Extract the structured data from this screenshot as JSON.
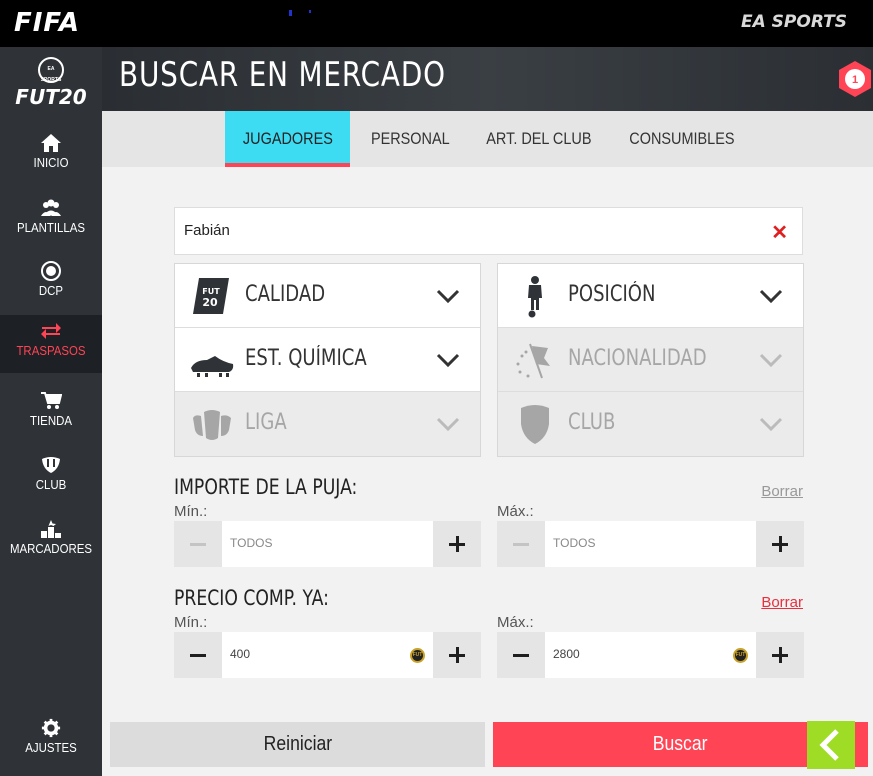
{
  "topbar": {
    "brand": "FIFA",
    "publisher": "EA SPORTS"
  },
  "sidebar": {
    "logo_small": "EA SPORTS",
    "logo": "FUT20",
    "items": [
      {
        "label": "INICIO",
        "icon": "home-icon"
      },
      {
        "label": "PLANTILLAS",
        "icon": "squads-icon"
      },
      {
        "label": "DCP",
        "icon": "sbc-icon"
      },
      {
        "label": "TRASPASOS",
        "icon": "transfers-icon",
        "active": true
      },
      {
        "label": "TIENDA",
        "icon": "store-icon"
      },
      {
        "label": "CLUB",
        "icon": "club-icon"
      },
      {
        "label": "MARCADORES",
        "icon": "leaderboards-icon"
      }
    ],
    "settings": {
      "label": "AJUSTES",
      "icon": "gear-icon"
    }
  },
  "header": {
    "title": "BUSCAR EN MERCADO",
    "badge_count": "1"
  },
  "tabs": [
    {
      "label": "JUGADORES",
      "active": true
    },
    {
      "label": "PERSONAL"
    },
    {
      "label": "ART. DEL CLUB"
    },
    {
      "label": "CONSUMIBLES"
    }
  ],
  "search": {
    "value": "Fabián"
  },
  "filters": {
    "left": [
      {
        "label": "CALIDAD",
        "icon": "quality-icon",
        "icon_text": "FUT 20",
        "enabled": true
      },
      {
        "label": "EST. QUÍMICA",
        "icon": "boot-icon",
        "enabled": true
      },
      {
        "label": "LIGA",
        "icon": "league-icon",
        "enabled": false
      }
    ],
    "right": [
      {
        "label": "POSICIÓN",
        "icon": "player-icon",
        "enabled": true
      },
      {
        "label": "NACIONALIDAD",
        "icon": "flag-icon",
        "enabled": false
      },
      {
        "label": "CLUB",
        "icon": "shield-icon",
        "enabled": false
      }
    ]
  },
  "bid": {
    "label": "IMPORTE DE LA PUJA:",
    "clear": "Borrar",
    "min_label": "Mín.:",
    "max_label": "Máx.:",
    "min_value": "TODOS",
    "max_value": "TODOS"
  },
  "buy_now": {
    "label": "PRECIO COMP. YA:",
    "clear": "Borrar",
    "min_label": "Mín.:",
    "max_label": "Máx.:",
    "min_value": "400",
    "max_value": "2800",
    "coin_text": "FUT"
  },
  "actions": {
    "reset": "Reiniciar",
    "search": "Buscar"
  },
  "colors": {
    "accent_cyan": "#3ddcf3",
    "accent_red": "#ff4455",
    "accent_green": "#9edc26",
    "sidebar": "#2f3338"
  }
}
